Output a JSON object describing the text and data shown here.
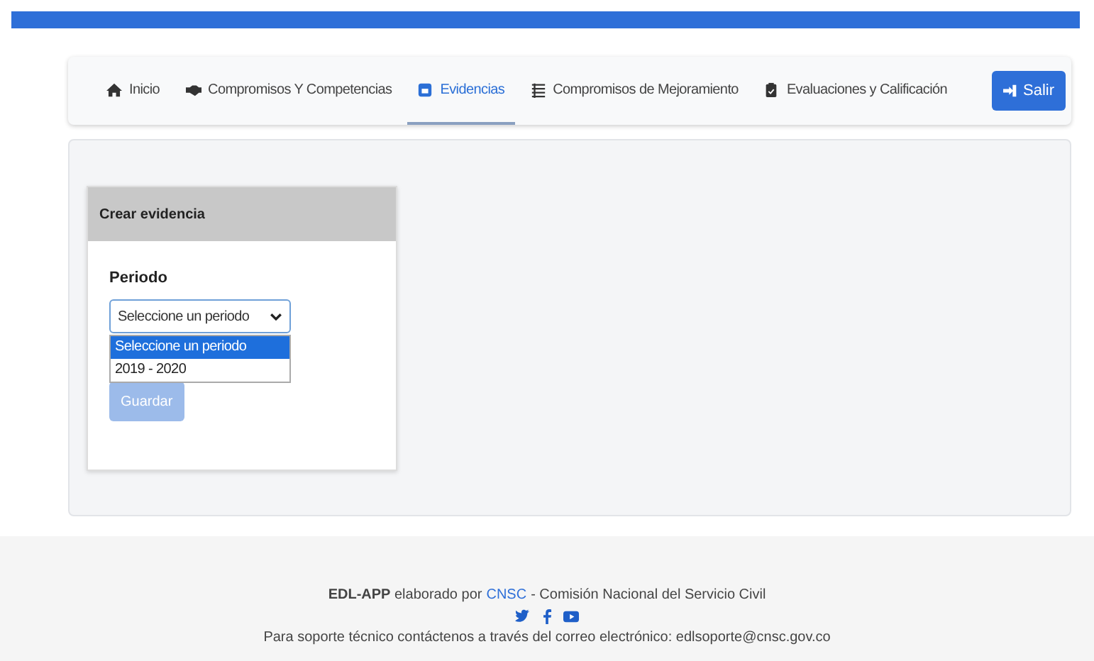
{
  "nav": {
    "tabs": [
      {
        "label": "Inicio",
        "kind": "home",
        "selected": false
      },
      {
        "label": "Compromisos Y Competencias",
        "kind": "handshake",
        "selected": false
      },
      {
        "label": "Evidencias",
        "kind": "lock",
        "selected": true
      },
      {
        "label": "Compromisos de Mejoramiento",
        "kind": "list",
        "selected": false
      },
      {
        "label": "Evaluaciones y Calificación",
        "kind": "clipboard",
        "selected": false
      }
    ],
    "logout": {
      "label": "Salir"
    }
  },
  "card": {
    "title": "Crear evidencia",
    "field_label": "Periodo",
    "select": {
      "value": "Seleccione un periodo",
      "expanded": true,
      "options": [
        {
          "label": "Seleccione un periodo",
          "selected": true
        },
        {
          "label": "2019 - 2020",
          "selected": false
        }
      ]
    },
    "button": {
      "label": "Guardar",
      "disabled": true
    }
  },
  "footer": {
    "credit": "**EDL-APP** elaborado por",
    "org_link": "CNSC",
    "org_name": "- Comisión Nacional del Servicio Civil",
    "social": [
      {
        "kind": "twitter"
      },
      {
        "kind": "facebook"
      },
      {
        "kind": "youtube"
      }
    ],
    "support": "Para soporte técnico contáctenos a través del correo electrónico: edlsoporte@cnsc.gov.co"
  }
}
